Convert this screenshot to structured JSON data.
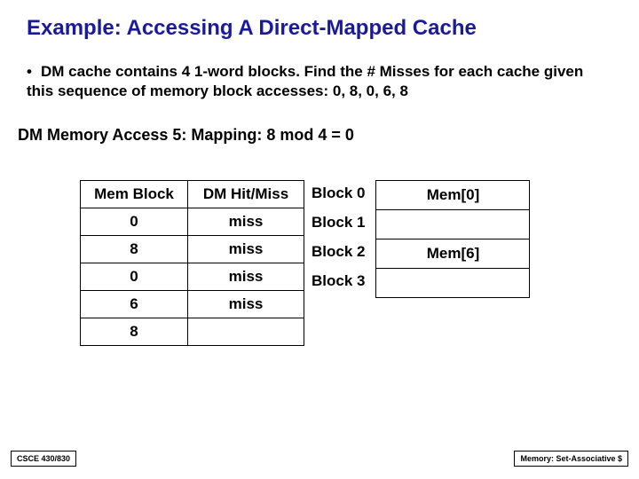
{
  "title": "Example: Accessing A Direct-Mapped Cache",
  "bullet": "DM cache contains 4 1-word blocks. Find the # Misses for each cache given this sequence of memory block accesses: 0, 8, 0, 6, 8",
  "subhead": "DM Memory Access 5:  Mapping: 8 mod 4 = 0",
  "access_table": {
    "headers": [
      "Mem Block",
      "DM Hit/Miss"
    ],
    "rows": [
      [
        "0",
        "miss"
      ],
      [
        "8",
        "miss"
      ],
      [
        "0",
        "miss"
      ],
      [
        "6",
        "miss"
      ],
      [
        "8",
        ""
      ]
    ]
  },
  "block_labels": [
    "Block 0",
    "Block 1",
    "Block 2",
    "Block 3"
  ],
  "cache_contents": [
    "Mem[0]",
    "",
    "Mem[6]",
    ""
  ],
  "footer_left": "CSCE 430/830",
  "footer_right": "Memory: Set-Associative $",
  "chart_data": {
    "type": "table",
    "title": "Direct-Mapped Cache Access Trace",
    "access_sequence": [
      {
        "mem_block": 0,
        "result": "miss"
      },
      {
        "mem_block": 8,
        "result": "miss"
      },
      {
        "mem_block": 0,
        "result": "miss"
      },
      {
        "mem_block": 6,
        "result": "miss"
      },
      {
        "mem_block": 8,
        "result": ""
      }
    ],
    "cache_state": [
      {
        "block": 0,
        "content": "Mem[0]"
      },
      {
        "block": 1,
        "content": ""
      },
      {
        "block": 2,
        "content": "Mem[6]"
      },
      {
        "block": 3,
        "content": ""
      }
    ],
    "mapping_rule": "8 mod 4 = 0",
    "num_blocks": 4
  }
}
